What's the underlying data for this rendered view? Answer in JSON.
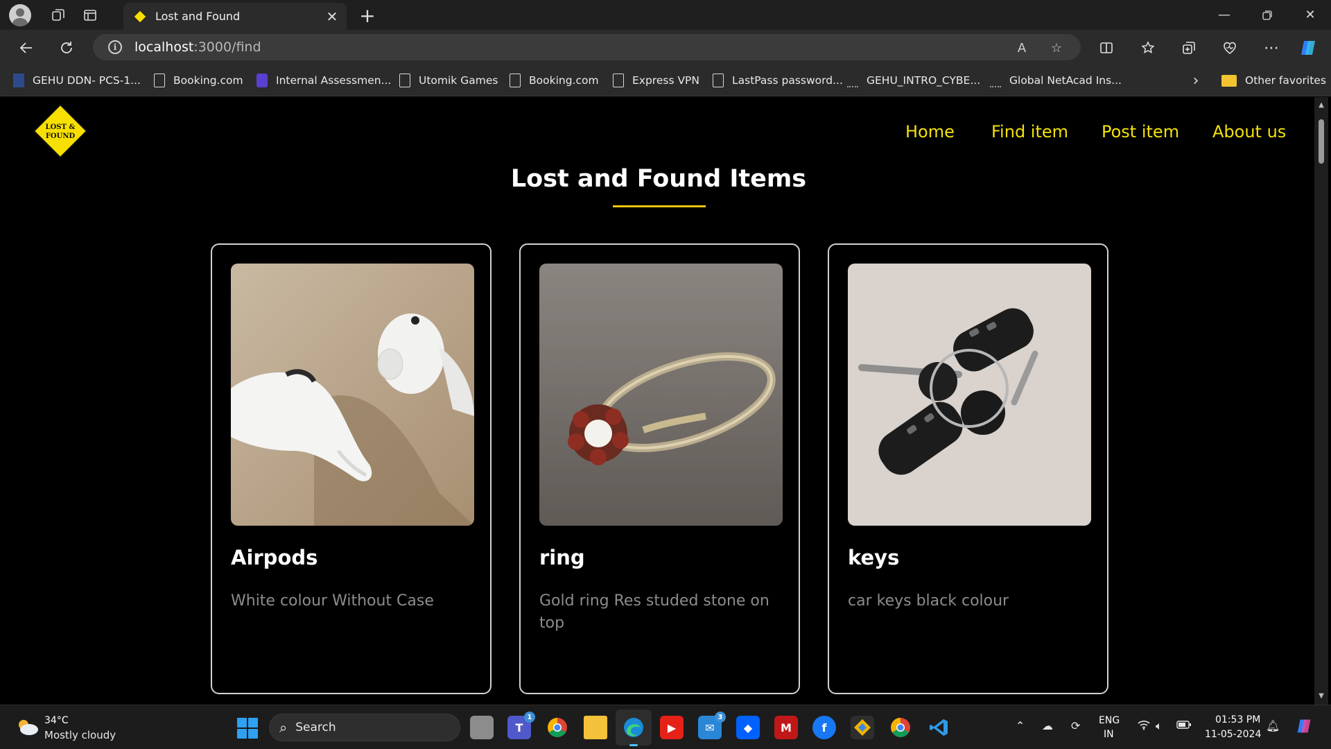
{
  "browser": {
    "tab_title": "Lost and Found",
    "url_host": "localhost",
    "url_path": ":3000/find",
    "bookmarks": [
      {
        "label": "GEHU DDN- PCS-1...",
        "icon": "gehu-icon"
      },
      {
        "label": "Booking.com",
        "icon": "page-icon"
      },
      {
        "label": "Internal Assessmen...",
        "icon": "form-icon"
      },
      {
        "label": "Utomik Games",
        "icon": "page-icon"
      },
      {
        "label": "Booking.com",
        "icon": "page-icon"
      },
      {
        "label": "Express VPN",
        "icon": "page-icon"
      },
      {
        "label": "LastPass password...",
        "icon": "page-icon"
      },
      {
        "label": "GEHU_INTRO_CYBE...",
        "icon": "cisco-icon"
      },
      {
        "label": "Global NetAcad Ins...",
        "icon": "cisco-icon"
      }
    ],
    "other_favorites": "Other favorites"
  },
  "site": {
    "logo_line1": "LOST &",
    "logo_line2": "FOUND",
    "nav": [
      "Home",
      "Find item",
      "Post item",
      "About us"
    ],
    "page_title": "Lost and Found Items",
    "items": [
      {
        "name": "Airpods",
        "description": "White colour Without Case",
        "image": "airpods-photo"
      },
      {
        "name": "ring",
        "description": "Gold ring Res studed stone on top",
        "image": "ring-photo"
      },
      {
        "name": "keys",
        "description": "car keys black colour",
        "image": "keys-photo"
      }
    ],
    "colors": {
      "accent": "#f3e10d",
      "underline": "#f3c20d",
      "background": "#000000"
    }
  },
  "taskbar": {
    "weather_temp": "34°C",
    "weather_desc": "Mostly cloudy",
    "search_label": "Search",
    "teams_badge": "1",
    "mail_badge": "3",
    "lang_line1": "ENG",
    "lang_line2": "IN",
    "time": "01:53 PM",
    "date": "11-05-2024"
  }
}
